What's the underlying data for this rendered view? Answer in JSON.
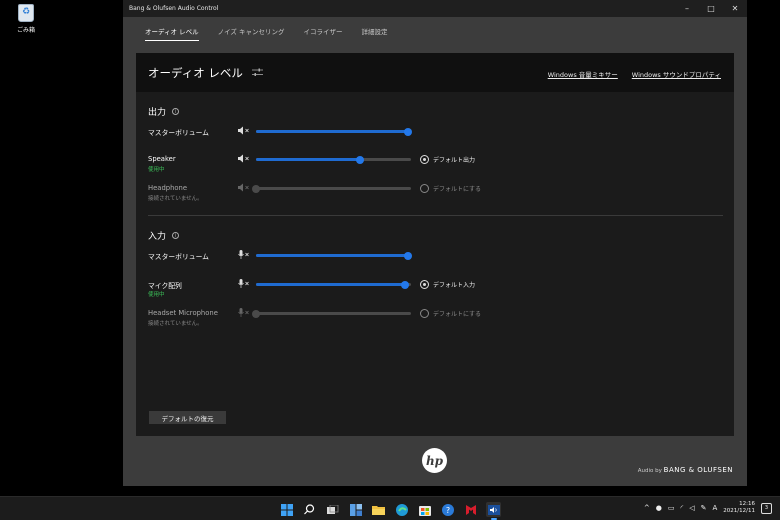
{
  "desktop": {
    "recycle_bin_label": "ごみ箱"
  },
  "window": {
    "title": "Bang & Olufsen Audio Control",
    "controls": {
      "minimize": "–",
      "maximize": "□",
      "close": "✕"
    }
  },
  "tabs": [
    {
      "label": "オーディオ レベル",
      "active": true
    },
    {
      "label": "ノイズ キャンセリング",
      "active": false
    },
    {
      "label": "イコライザー",
      "active": false
    },
    {
      "label": "詳細設定",
      "active": false
    }
  ],
  "panel": {
    "title": "オーディオ レベル",
    "links": {
      "mixer": "Windows 音量ミキサー",
      "sound_properties": "Windows サウンドプロパティ"
    }
  },
  "output": {
    "title": "出力",
    "master": {
      "name": "マスターボリューム",
      "level": 0.98
    },
    "devices": [
      {
        "name": "Speaker",
        "status": "使用中",
        "level": 0.67,
        "radio_label": "デフォルト出力",
        "is_default": true,
        "enabled": true
      },
      {
        "name": "Headphone",
        "status": "接続されていません。",
        "level": 0.0,
        "radio_label": "デフォルトにする",
        "is_default": false,
        "enabled": false
      }
    ]
  },
  "input": {
    "title": "入力",
    "master": {
      "name": "マスターボリューム",
      "level": 0.98
    },
    "devices": [
      {
        "name": "マイク配列",
        "status": "使用中",
        "level": 0.96,
        "radio_label": "デフォルト入力",
        "is_default": true,
        "enabled": true
      },
      {
        "name": "Headset Microphone",
        "status": "接続されていません。",
        "level": 0.0,
        "radio_label": "デフォルトにする",
        "is_default": false,
        "enabled": false
      }
    ]
  },
  "reset_button": "デフォルトの復元",
  "footer": {
    "hp_logo": "hp",
    "audio_by_prefix": "Audio by",
    "brand": "BANG & OLUFSEN"
  },
  "taskbar": {
    "icons": [
      "windows-start-icon",
      "search-icon",
      "task-view-icon",
      "widgets-icon",
      "file-explorer-icon",
      "edge-icon",
      "store-icon",
      "help-icon",
      "mcafee-icon",
      "audio-control-icon"
    ],
    "time": "12:16",
    "date": "2021/12/11",
    "ime": "A",
    "notification_count": "3"
  },
  "colors": {
    "accent": "#2378ea",
    "active_status": "#3cc35a"
  }
}
